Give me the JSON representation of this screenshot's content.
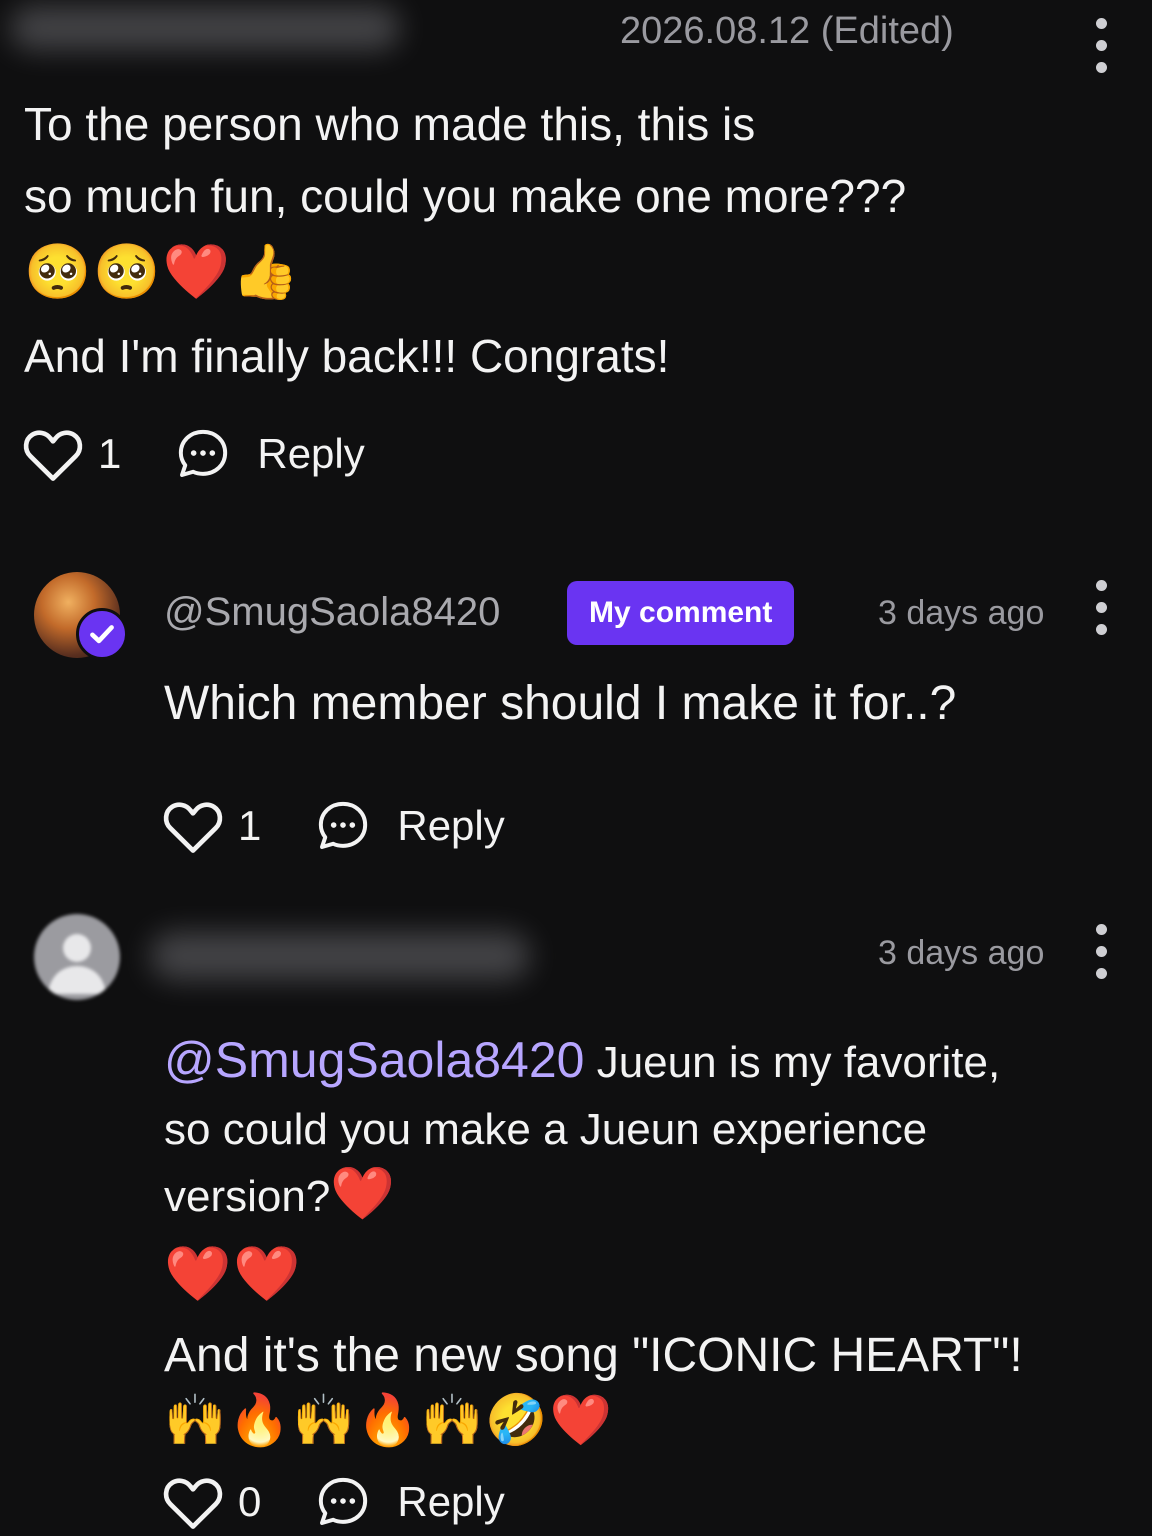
{
  "comment1": {
    "timestamp": "2026.08.12 (Edited)",
    "lines": [
      "To the person who made this, this is",
      "so much fun, could you make one more???"
    ],
    "emojis": "🥺🥺❤️👍",
    "line3": "And I'm finally back!!! Congrats!",
    "likes": "1",
    "reply_label": "Reply"
  },
  "comment2": {
    "handle": "@SmugSaola8420",
    "badge": "My comment",
    "timestamp": "3 days ago",
    "text": "Which member should I make it for..?",
    "likes": "1",
    "reply_label": "Reply"
  },
  "comment3": {
    "timestamp": "3 days ago",
    "mention": "@SmugSaola8420",
    "line1_rest": " Jueun is my favorite,",
    "line2": "so could you make a Jueun experience",
    "line3": "version?",
    "line3_emoji": "❤️",
    "emoji_row1": "❤️❤️",
    "line4": "And it's the new song \"ICONIC HEART\"!",
    "emoji_row2": "🙌🔥🙌🔥🙌🤣❤️",
    "likes": "0",
    "reply_label": "Reply"
  },
  "colors": {
    "background": "#0f0f10",
    "badge": "#6a34f2",
    "mention": "#b7a6ff",
    "muted": "#9a9aa0"
  }
}
